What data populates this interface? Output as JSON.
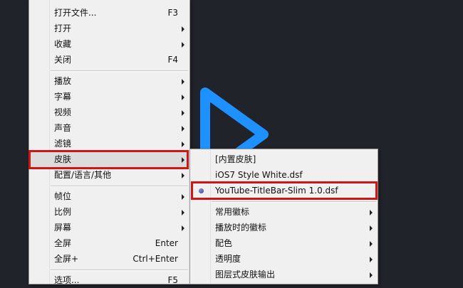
{
  "main_menu": {
    "items": [
      {
        "label": "打开文件...",
        "shortcut": "F3",
        "submenu": false
      },
      {
        "label": "打开",
        "shortcut": "",
        "submenu": true
      },
      {
        "label": "收藏",
        "shortcut": "",
        "submenu": true
      },
      {
        "label": "关闭",
        "shortcut": "F4",
        "submenu": false
      },
      {
        "label": "播放",
        "shortcut": "",
        "submenu": true
      },
      {
        "label": "字幕",
        "shortcut": "",
        "submenu": true
      },
      {
        "label": "视频",
        "shortcut": "",
        "submenu": true
      },
      {
        "label": "声音",
        "shortcut": "",
        "submenu": true
      },
      {
        "label": "滤镜",
        "shortcut": "",
        "submenu": true
      },
      {
        "label": "皮肤",
        "shortcut": "",
        "submenu": true,
        "active": true
      },
      {
        "label": "配置/语言/其他",
        "shortcut": "",
        "submenu": true
      },
      {
        "label": "帧位",
        "shortcut": "",
        "submenu": true
      },
      {
        "label": "比例",
        "shortcut": "",
        "submenu": true
      },
      {
        "label": "屏幕",
        "shortcut": "",
        "submenu": true
      },
      {
        "label": "全屏",
        "shortcut": "Enter",
        "submenu": false
      },
      {
        "label": "全屏+",
        "shortcut": "Ctrl+Enter",
        "submenu": false
      },
      {
        "label": "选项...",
        "shortcut": "F5",
        "submenu": false
      }
    ]
  },
  "skin_submenu": {
    "items": [
      {
        "label": "[内置皮肤]",
        "submenu": false
      },
      {
        "label": "iOS7 Style White.dsf",
        "submenu": false
      },
      {
        "label": "YouTube-TitleBar-Slim 1.0.dsf",
        "submenu": false,
        "selected": true
      },
      {
        "label": "常用徽标",
        "submenu": true
      },
      {
        "label": "播放时的徽标",
        "submenu": true
      },
      {
        "label": "配色",
        "submenu": true
      },
      {
        "label": "透明度",
        "submenu": true
      },
      {
        "label": "图层式皮肤输出",
        "submenu": true
      }
    ]
  },
  "colors": {
    "background": "#21232a",
    "menu_bg": "#f0f0f0",
    "highlight_border": "#d01515",
    "play_logo": "#1e90ff"
  },
  "icons": {
    "background_logo": "play-triangle-icon",
    "submenu_indicator": "chevron-right-icon",
    "selected_indicator": "radio-dot-icon"
  }
}
